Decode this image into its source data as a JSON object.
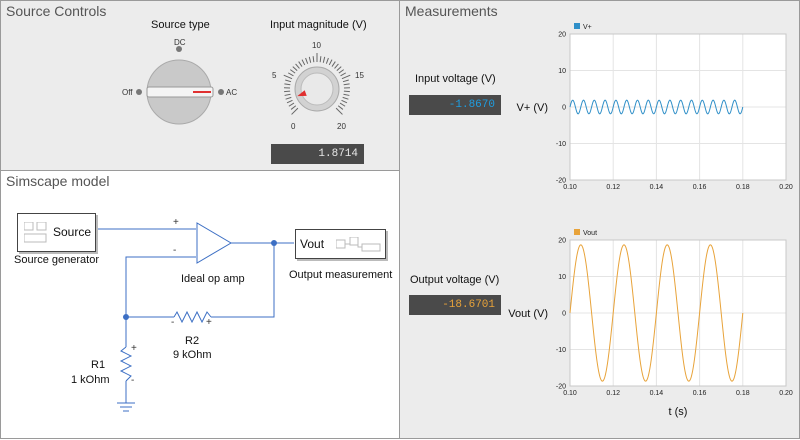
{
  "source_controls": {
    "title": "Source Controls",
    "source_type": {
      "label": "Source type",
      "options": [
        "DC",
        "Off",
        "AC"
      ],
      "selected": "AC"
    },
    "magnitude": {
      "label": "Input magnitude (V)",
      "ticks": [
        "0",
        "5",
        "10",
        "15",
        "20"
      ],
      "value": 1.8714,
      "display": "1.8714"
    }
  },
  "model": {
    "title": "Simscape model",
    "source_block": {
      "port_label": "Source",
      "caption": "Source generator"
    },
    "opamp": {
      "caption": "Ideal op amp",
      "plus": "+",
      "minus": "-"
    },
    "output_block": {
      "port_label": "Vout",
      "caption": "Output measurement"
    },
    "r1": {
      "name": "R1",
      "value": "1 kOhm",
      "plus": "+",
      "minus": "-"
    },
    "r2": {
      "name": "R2",
      "value": "9 kOhm",
      "plus": "+",
      "minus": "-"
    }
  },
  "measurements": {
    "title": "Measurements",
    "input_voltage": {
      "label": "Input voltage (V)",
      "display": "-1.8670",
      "color": "#1f9de0"
    },
    "output_voltage": {
      "label": "Output voltage (V)",
      "display": "-18.6701",
      "color": "#e8a33a"
    }
  },
  "chart_data": [
    {
      "type": "line",
      "series": [
        {
          "name": "V+",
          "color": "#2f8fc8",
          "amplitude": 1.867,
          "frequency_hz": 200,
          "x_start": 0.1,
          "x_end": 0.18
        }
      ],
      "ylabel": "V+ (V)",
      "xlim": [
        0.1,
        0.2
      ],
      "ylim": [
        -20,
        20
      ],
      "xticks": [
        "0.10",
        "0.12",
        "0.14",
        "0.16",
        "0.18",
        "0.20"
      ],
      "yticks": [
        "-20",
        "-10",
        "0",
        "10",
        "20"
      ],
      "grid": true,
      "legend": "top-left"
    },
    {
      "type": "line",
      "series": [
        {
          "name": "Vout",
          "color": "#e8a33a",
          "amplitude": 18.67,
          "frequency_hz": 50,
          "x_start": 0.1,
          "x_end": 0.18
        }
      ],
      "xlabel": "t (s)",
      "ylabel": "Vout (V)",
      "xlim": [
        0.1,
        0.2
      ],
      "ylim": [
        -20,
        20
      ],
      "xticks": [
        "0.10",
        "0.12",
        "0.14",
        "0.16",
        "0.18",
        "0.20"
      ],
      "yticks": [
        "-20",
        "-10",
        "0",
        "10",
        "20"
      ],
      "grid": true,
      "legend": "top-left"
    }
  ]
}
